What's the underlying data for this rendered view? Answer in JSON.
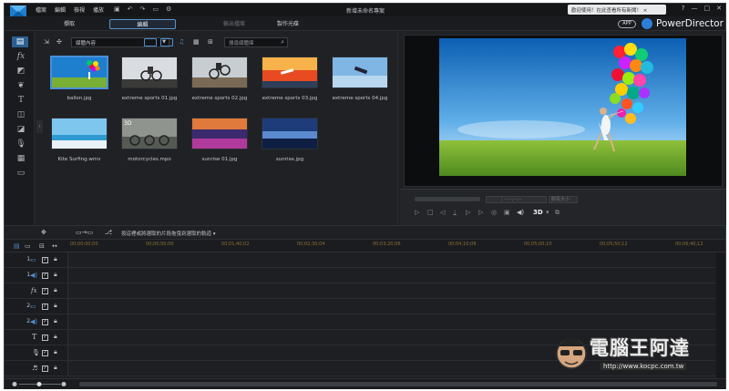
{
  "titlebar": {
    "menu": [
      "檔案",
      "編輯",
      "檢視",
      "播放"
    ],
    "document_title": "新增未命名專案",
    "notice": "歡迎使用！在此查看所有新聞！ ×",
    "window_buttons": [
      "?",
      "—",
      "□",
      "✕"
    ]
  },
  "modes": [
    {
      "label": "擷取",
      "state": "normal"
    },
    {
      "label": "編輯",
      "state": "active"
    },
    {
      "label": "輸出檔案",
      "state": "disabled"
    },
    {
      "label": "製作光碟",
      "state": "normal"
    }
  ],
  "brand": {
    "app_badge": "APP",
    "name": "PowerDirector"
  },
  "library": {
    "filter_label": "媒體內容",
    "search_placeholder": "搜尋媒體庫",
    "items": [
      {
        "name": "ballon.jpg",
        "selected": true
      },
      {
        "name": "extreme sports 01.jpg",
        "selected": false
      },
      {
        "name": "extreme sports 02.jpg",
        "selected": false
      },
      {
        "name": "extreme sports 03.jpg",
        "selected": false
      },
      {
        "name": "extreme sports 04.jpg",
        "selected": false
      },
      {
        "name": "Kite Surfing.wmv",
        "selected": false
      },
      {
        "name": "motorcycles.mpo",
        "selected": false,
        "badge": "3D"
      },
      {
        "name": "sunrise 01.jpg",
        "selected": false
      },
      {
        "name": "sunrise.jpg",
        "selected": false
      }
    ]
  },
  "preview": {
    "timecode": "--:--;--;--",
    "mode_label": "觀看大小",
    "badge_3d": "3D"
  },
  "timeline": {
    "hint": "按這裡或將選取的片段拖曳到選取的軌道 ▾",
    "ruler": [
      "00;00;00;00",
      "00;00;50;00",
      "00;01;40;02",
      "00;02;30;04",
      "00;03;20;06",
      "00;04;10;08",
      "00;05;00;10",
      "00;05;50;12",
      "00;06;40;12"
    ],
    "tracks": [
      {
        "number": "1.",
        "kind": "video-icon"
      },
      {
        "number": "1.",
        "kind": "audio-icon"
      },
      {
        "number": "",
        "kind": "fx-icon"
      },
      {
        "number": "2.",
        "kind": "video-icon"
      },
      {
        "number": "2.",
        "kind": "audio-icon"
      },
      {
        "number": "",
        "kind": "title-icon"
      },
      {
        "number": "",
        "kind": "voice-icon"
      },
      {
        "number": "",
        "kind": "music-icon"
      }
    ]
  },
  "watermark": {
    "title": "電腦王阿達",
    "url": "http://www.kocpc.com.tw"
  },
  "colors": {
    "accent": "#4a8fd8",
    "bg": "#1d1f22",
    "ruler_text": "#8a6f37"
  }
}
